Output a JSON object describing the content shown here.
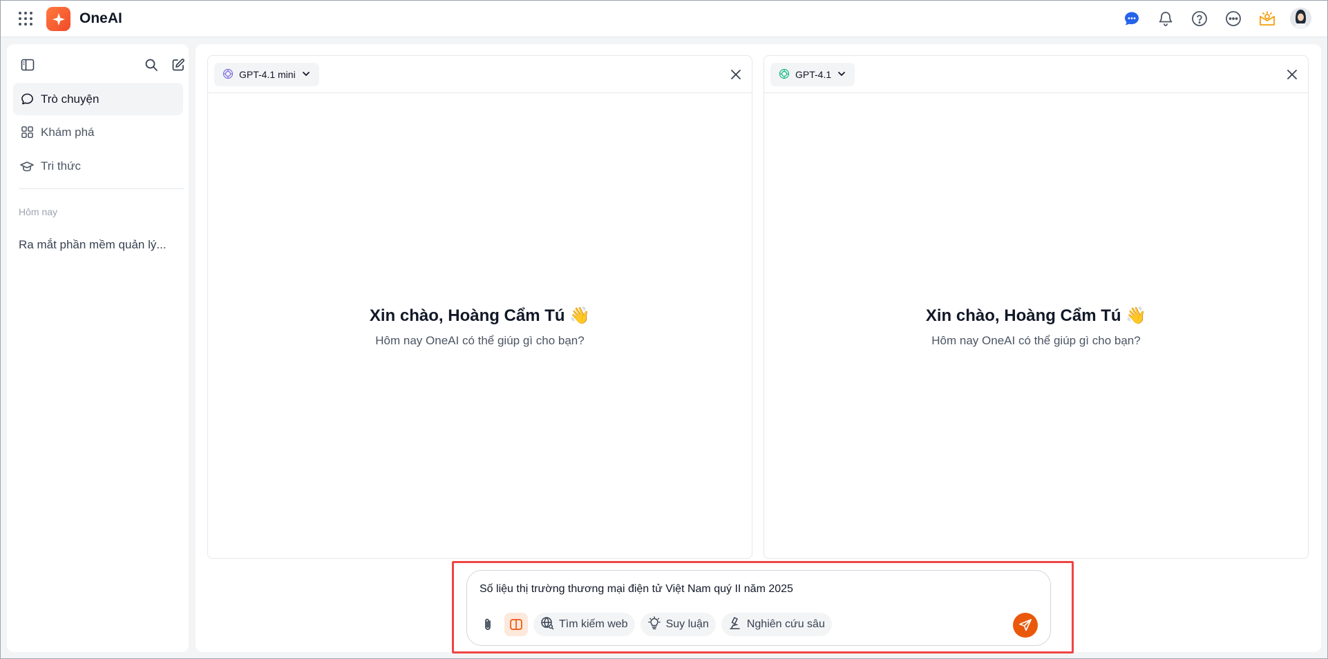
{
  "app": {
    "brand": "OneAI"
  },
  "topbar": {
    "icons": [
      "apps-grid-icon",
      "chat-bubble-icon",
      "bell-icon",
      "help-icon",
      "more-icon",
      "lamp-idea-icon",
      "user-avatar"
    ]
  },
  "sidebar": {
    "nav": [
      {
        "label": "Trò chuyện",
        "icon": "chat-icon",
        "active": true
      },
      {
        "label": "Khám phá",
        "icon": "grid-icon",
        "active": false
      },
      {
        "label": "Tri thức",
        "icon": "graduation-cap-icon",
        "active": false
      }
    ],
    "section_label": "Hôm nay",
    "history": [
      "Ra mắt phần mềm quản lý..."
    ]
  },
  "panels": [
    {
      "model": "GPT-4.1 mini",
      "greeting": "Xin chào, Hoàng Cẩm Tú 👋",
      "subtitle": "Hôm nay OneAI có thể giúp gì cho bạn?"
    },
    {
      "model": "GPT-4.1",
      "greeting": "Xin chào, Hoàng Cẩm Tú 👋",
      "subtitle": "Hôm nay OneAI có thể giúp gì cho bạn?"
    }
  ],
  "composer": {
    "value": "Số liệu thị trường thương mại điện tử Việt Nam quý II năm 2025",
    "tools": {
      "web_search": "Tìm kiếm web",
      "reasoning": "Suy luận",
      "deep_research": "Nghiên cứu sâu"
    }
  },
  "colors": {
    "accent": "#ea580c",
    "brand_gradient_start": "#ff7a3d",
    "brand_gradient_end": "#f04a2a",
    "highlight_box": "#ef4444"
  }
}
